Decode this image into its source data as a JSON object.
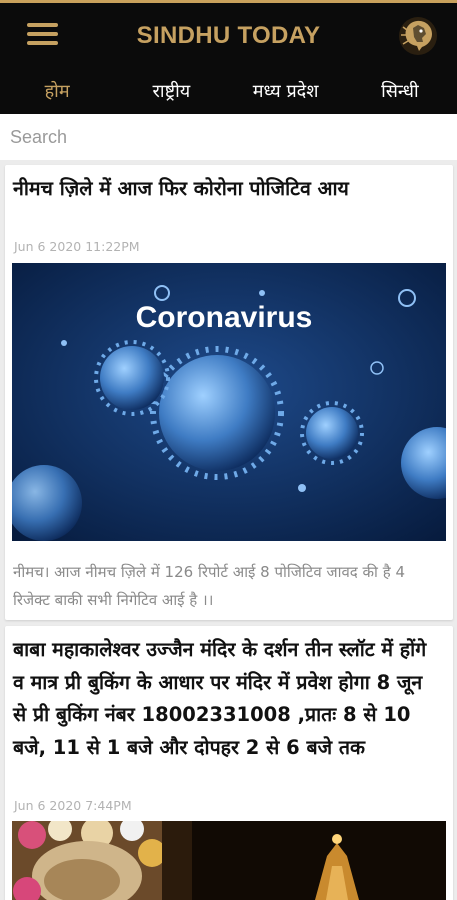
{
  "header": {
    "app_title": "SINDHU TODAY",
    "menu_icon": "hamburger-menu-icon",
    "logo": "lion-logo",
    "accent_color": "#c6a161",
    "background_color": "#0b0b0b"
  },
  "tabs": [
    {
      "label": "होम",
      "active": true
    },
    {
      "label": "राष्ट्रीय",
      "active": false
    },
    {
      "label": "मध्य प्रदेश",
      "active": false
    },
    {
      "label": "सिन्धी",
      "active": false
    }
  ],
  "search": {
    "placeholder": "Search",
    "value": ""
  },
  "articles": [
    {
      "title": "नीमच ज़िले में आज फिर कोरोना पोजिटिव आय",
      "date": "Jun  6 2020 11:22PM",
      "image_caption": "Coronavirus",
      "summary": "नीमच। आज नीमच ज़िले में 126 रिपोर्ट आई 8 पोजिटिव जावद की है 4 रिजेक्ट बाकी  सभी निगेटिव आई है ।।"
    },
    {
      "title": "बाबा महाकालेश्वर उज्जैन मंदिर के दर्शन तीन स्लॉट में होंगे व मात्र प्री बुकिंग के आधार पर मंदिर में प्रवेश होगा 8 जून से प्री बुकिंग नंबर 18002331008 ,प्रातः 8 से 10 बजे, 11 से 1 बजे और दोपहर 2 से 6 बजे तक",
      "date": "Jun  6 2020  7:44PM"
    }
  ]
}
